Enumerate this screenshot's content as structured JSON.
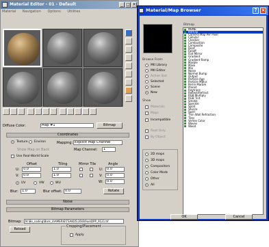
{
  "material_editor": {
    "title": "Material Editor - 01 - Default",
    "menu": [
      "Material",
      "Navigation",
      "Options",
      "Utilities"
    ],
    "diffuse_label": "Diffuse Color:",
    "map_name": "Map #1",
    "map_type": "Bitmap",
    "coordinates": {
      "rollout_title": "Coordinates",
      "texture_label": "Texture",
      "environ_label": "Environ",
      "mapping_label": "Mapping:",
      "mapping_value": "Explicit Map Channel",
      "show_map_back_label": "Show Map on Back",
      "map_channel_label": "Map Channel:",
      "map_channel_value": "1",
      "use_real_world_label": "Use Real-World Scale",
      "offset_label": "Offset",
      "tiling_label": "Tiling",
      "mirror_tile_label": "Mirror Tile",
      "angle_label": "Angle",
      "u_label": "U:",
      "v_label": "V:",
      "w_label": "W:",
      "u_offset": "0.0",
      "v_offset": "0.0",
      "u_tiling": "1.0",
      "v_tiling": "1.0",
      "u_angle": "0.0",
      "v_angle": "0.0",
      "w_angle": "0.0",
      "uv_label": "UV",
      "vw_label": "VW",
      "wu_label": "WU",
      "blur_label": "Blur:",
      "blur_value": "1.0",
      "blur_offset_label": "Blur offset:",
      "blur_offset_value": "0.0",
      "rotate_label": "Rotate"
    },
    "noise_rollout": "Noise",
    "bitmap_params_rollout": "Bitmap Parameters",
    "bitmap_label": "Bitmap:",
    "bitmap_path": "N:\\Bo_coding\\Bark_U\\AMERIE\\TSAKO5\\16\\8\\9ue\\DPP_9121.tif",
    "reload_label": "Reload",
    "cropping_label": "Cropping/Placement",
    "apply_label": "Apply"
  },
  "browser": {
    "title": "Material/Map Browser",
    "selected_name": "Bitmap",
    "browse_from_label": "Browse From:",
    "browse_from": [
      "Mtl Library",
      "Mtl Editor",
      "Active Slot",
      "Selected",
      "Scene",
      "New"
    ],
    "browse_selected_index": 5,
    "show_label": "Show",
    "show_options": [
      "Materials",
      "Maps",
      "Incompatible"
    ],
    "root_only_label": "Root Only",
    "by_object_label": "By Object",
    "map_filters": [
      "2D maps",
      "3D maps",
      "Compositors",
      "Color Mods",
      "Other",
      "All"
    ],
    "map_filter_selected_index": 5,
    "items": [
      "NONE",
      "Bitmap",
      "Camera Map Per Pixel",
      "Cellular",
      "Checker",
      "Combustion",
      "Composite",
      "Dent",
      "Falloff",
      "Flat Mirror",
      "Gradient",
      "Gradient Ramp",
      "Marble",
      "Mask",
      "Mix",
      "Noise",
      "Normal Bump",
      "Output",
      "Particle Age",
      "Particle MBlur",
      "Perlin Marble",
      "Planet",
      "Raytrace",
      "Reflect/Refract",
      "RGB Multiply",
      "RGB Tint",
      "Smoke",
      "Speckle",
      "Splat",
      "Stucco",
      "Swirl",
      "Thin Wall Refraction",
      "Tiles",
      "Vertex Color",
      "Waves",
      "Wood"
    ],
    "selected_item_index": 1,
    "ok_label": "OK",
    "cancel_label": "Cancel",
    "colors": {
      "title_bar": "#0a3ac8",
      "selection": "#0a3ac8"
    }
  }
}
